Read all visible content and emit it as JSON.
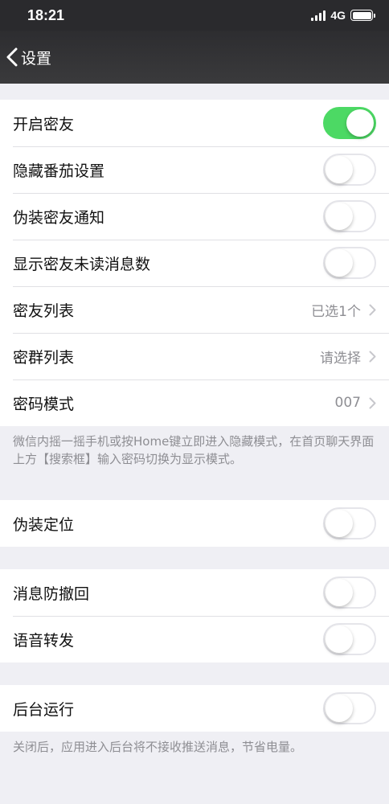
{
  "status_bar": {
    "time": "18:21",
    "network": "4G"
  },
  "nav": {
    "back_label": "设置"
  },
  "colors": {
    "toggle_on": "#4cd964",
    "nav_bg": "#2d2d30",
    "secondary_text": "#8e8e93"
  },
  "group1": {
    "items": [
      {
        "label": "开启密友",
        "toggle": true
      },
      {
        "label": "隐藏番茄设置",
        "toggle": false
      },
      {
        "label": "伪装密友通知",
        "toggle": false
      },
      {
        "label": "显示密友未读消息数",
        "toggle": false
      },
      {
        "label": "密友列表",
        "value": "已选1个"
      },
      {
        "label": "密群列表",
        "value": "请选择"
      },
      {
        "label": "密码模式",
        "value": "007"
      }
    ],
    "footnote": "微信内摇一摇手机或按Home键立即进入隐藏模式，在首页聊天界面上方【搜索框】输入密码切换为显示模式。"
  },
  "group2": {
    "items": [
      {
        "label": "伪装定位",
        "toggle": false
      }
    ]
  },
  "group3": {
    "items": [
      {
        "label": "消息防撤回",
        "toggle": false
      },
      {
        "label": "语音转发",
        "toggle": false
      }
    ]
  },
  "group4": {
    "items": [
      {
        "label": "后台运行",
        "toggle": false
      }
    ],
    "footnote": "关闭后，应用进入后台将不接收推送消息，节省电量。"
  }
}
